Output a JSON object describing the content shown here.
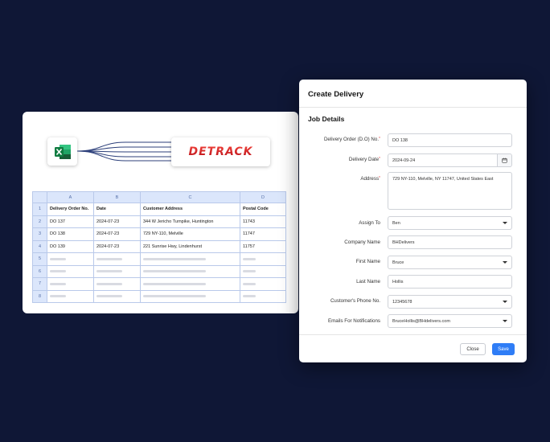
{
  "colors": {
    "background": "#0f1736",
    "accent": "#2f7df6",
    "detrack_red": "#d0202a",
    "excel_green": "#1f7a45"
  },
  "integration": {
    "source_icon": "excel-icon",
    "target_logo": "DETRACK"
  },
  "spreadsheet": {
    "columns": [
      "A",
      "B",
      "C",
      "D"
    ],
    "row_numbers": [
      "1",
      "2",
      "3",
      "4",
      "5",
      "6",
      "7",
      "8"
    ],
    "header": [
      "Delivery Order No.",
      "Date",
      "Customer Address",
      "Postal Code"
    ],
    "rows": [
      [
        "DO 137",
        "2024-07-23",
        "344 W Jericho Turnpike, Huntington",
        "11743"
      ],
      [
        "DO 138",
        "2024-07-23",
        "729 NY-110, Melville",
        "11747"
      ],
      [
        "DO 139",
        "2024-07-23",
        "221 Sunrise Hwy, Lindenhurst",
        "11757"
      ]
    ]
  },
  "modal": {
    "title": "Create Delivery",
    "section": "Job Details",
    "fields": {
      "do_no": {
        "label": "Delivery Order (D.O) No.",
        "value": "DO 138"
      },
      "delivery_date": {
        "label": "Delivery Date",
        "value": "2024-09-24"
      },
      "address": {
        "label": "Address",
        "value": "729 NY-110, Melville, NY 11747, United States East"
      },
      "assign_to": {
        "label": "Assign To",
        "value": "Ben"
      },
      "company_name": {
        "label": "Company Name",
        "value": "BHDelivers"
      },
      "first_name": {
        "label": "First Name",
        "value": "Bruce"
      },
      "last_name": {
        "label": "Last Name",
        "value": "Hollis"
      },
      "phone": {
        "label": "Customer's Phone No.",
        "value": "12345678"
      },
      "emails": {
        "label": "Emails For Notifications",
        "value": "BruceHollis@BHdelivers.com"
      }
    },
    "close_label": "Close",
    "save_label": "Save"
  }
}
